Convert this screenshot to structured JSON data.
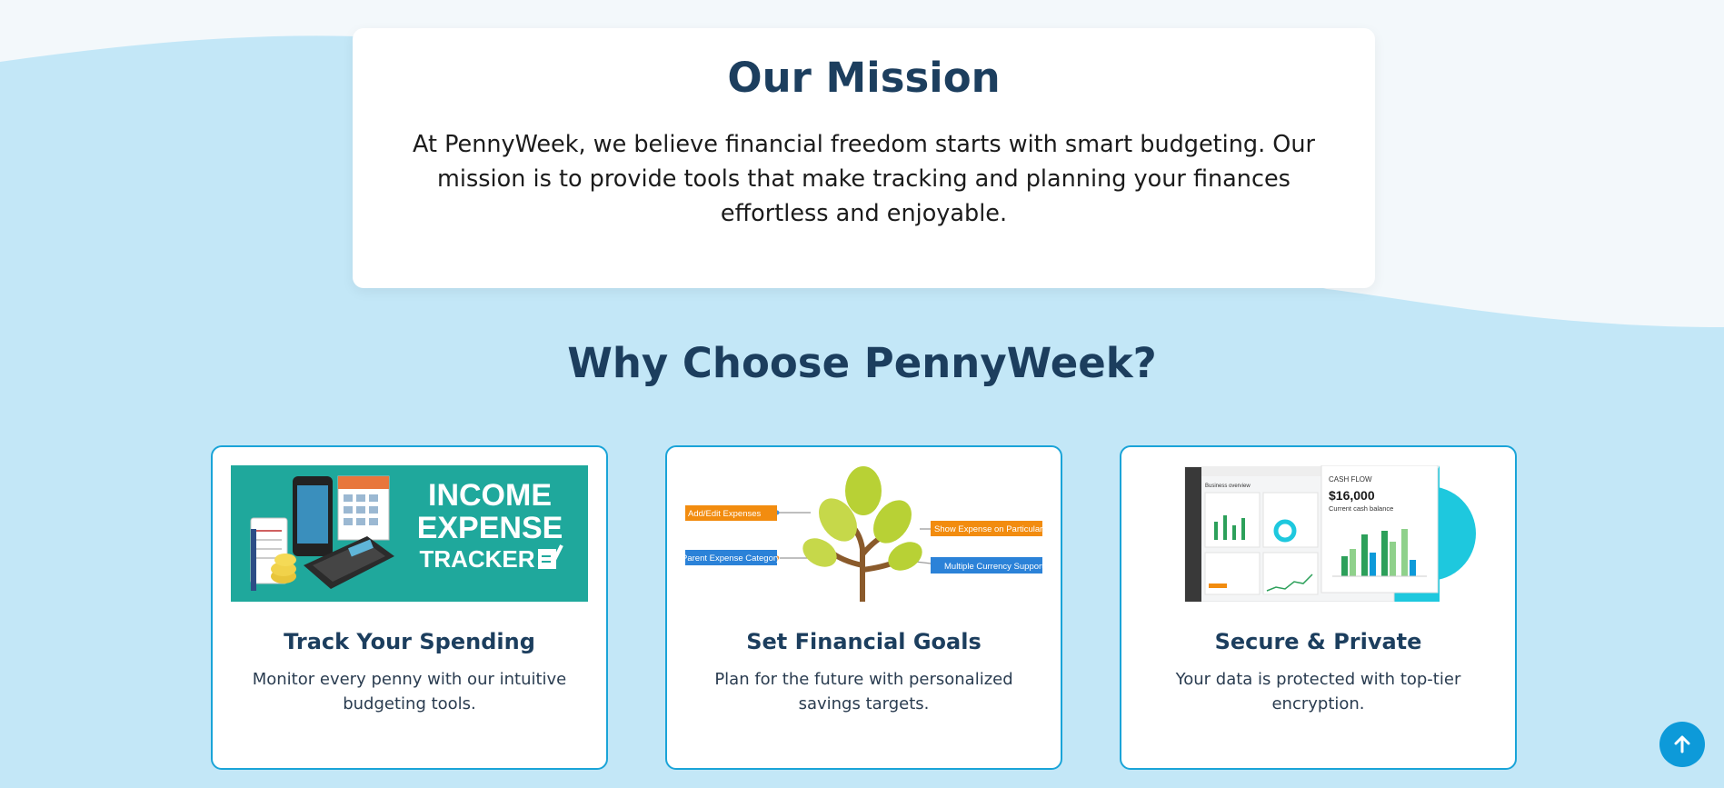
{
  "mission": {
    "title": "Our Mission",
    "text": "At PennyWeek, we believe financial freedom starts with smart budgeting. Our mission is to provide tools that make tracking and planning your finances effortless and enjoyable."
  },
  "why": {
    "title": "Why Choose PennyWeek?"
  },
  "features": [
    {
      "title": "Track Your Spending",
      "description": "Monitor every penny with our intuitive budgeting tools.",
      "image": {
        "line1": "INCOME",
        "line2": "EXPENSE",
        "line3": "TRACKER"
      }
    },
    {
      "title": "Set Financial Goals",
      "description": "Plan for the future with personalized savings targets.",
      "image": {
        "tag1": "Add/Edit Expenses",
        "tag2": "Parent Expense Category",
        "tag3": "Show Expense on Particular Cost",
        "tag4": "Multiple Currency Support"
      }
    },
    {
      "title": "Secure & Private",
      "description": "Your data is protected with top-tier encryption.",
      "image": {
        "panel_title": "Business overview",
        "cf_label": "CASH FLOW",
        "cf_amount": "$16,000",
        "cf_sub": "Current cash balance"
      }
    }
  ],
  "icons": {
    "scroll_top": "arrow-up-icon"
  },
  "colors": {
    "heading": "#1c3e5e",
    "accent": "#1aa4d8",
    "background": "#c3e7f7",
    "scroll_button": "#0d9ad9"
  }
}
